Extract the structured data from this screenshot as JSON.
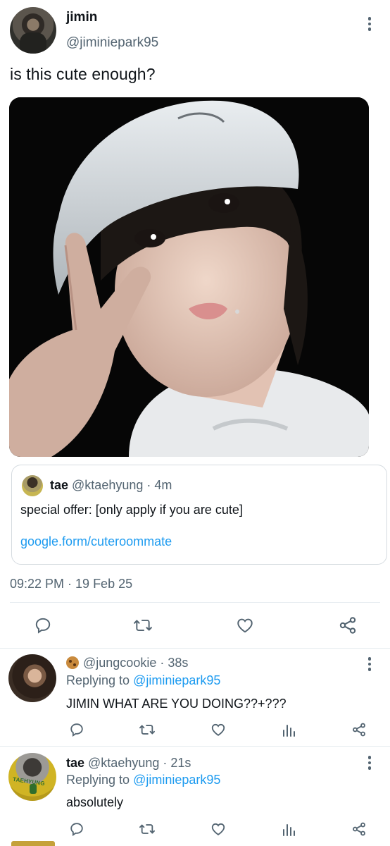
{
  "main_tweet": {
    "name": "jimin",
    "handle": "@jiminiepark95",
    "text": "is this cute enough?",
    "timestamp": "09:22 PM · 19 Feb 25",
    "quote": {
      "name": "tae",
      "handle": "@ktaehyung",
      "time": "· 4m",
      "text": "special offer: [only apply if you are cute]",
      "link": "google.form/cuteroommate"
    }
  },
  "replies": [
    {
      "emoji_name": "cookie",
      "handle": "@jungcookie",
      "time": "· 38s",
      "replying_prefix": "Replying to",
      "replying_to": "@jiminiepark95",
      "text": "JIMIN WHAT ARE YOU DOING??+???"
    },
    {
      "name": "tae",
      "handle": "@ktaehyung",
      "time": "· 21s",
      "replying_prefix": "Replying to",
      "replying_to": "@jiminiepark95",
      "text": "absolutely",
      "avatar_jersey_text": "TAEHYUNG"
    }
  ],
  "icons": {
    "reply": "reply-icon",
    "retweet": "retweet-icon",
    "like": "like-icon",
    "share": "share-icon",
    "analytics": "analytics-icon",
    "more": "more-icon"
  },
  "colors": {
    "link": "#1d9bf0",
    "secondary_text": "#536471",
    "icon": "#536471",
    "divider": "#e6ecf0"
  }
}
